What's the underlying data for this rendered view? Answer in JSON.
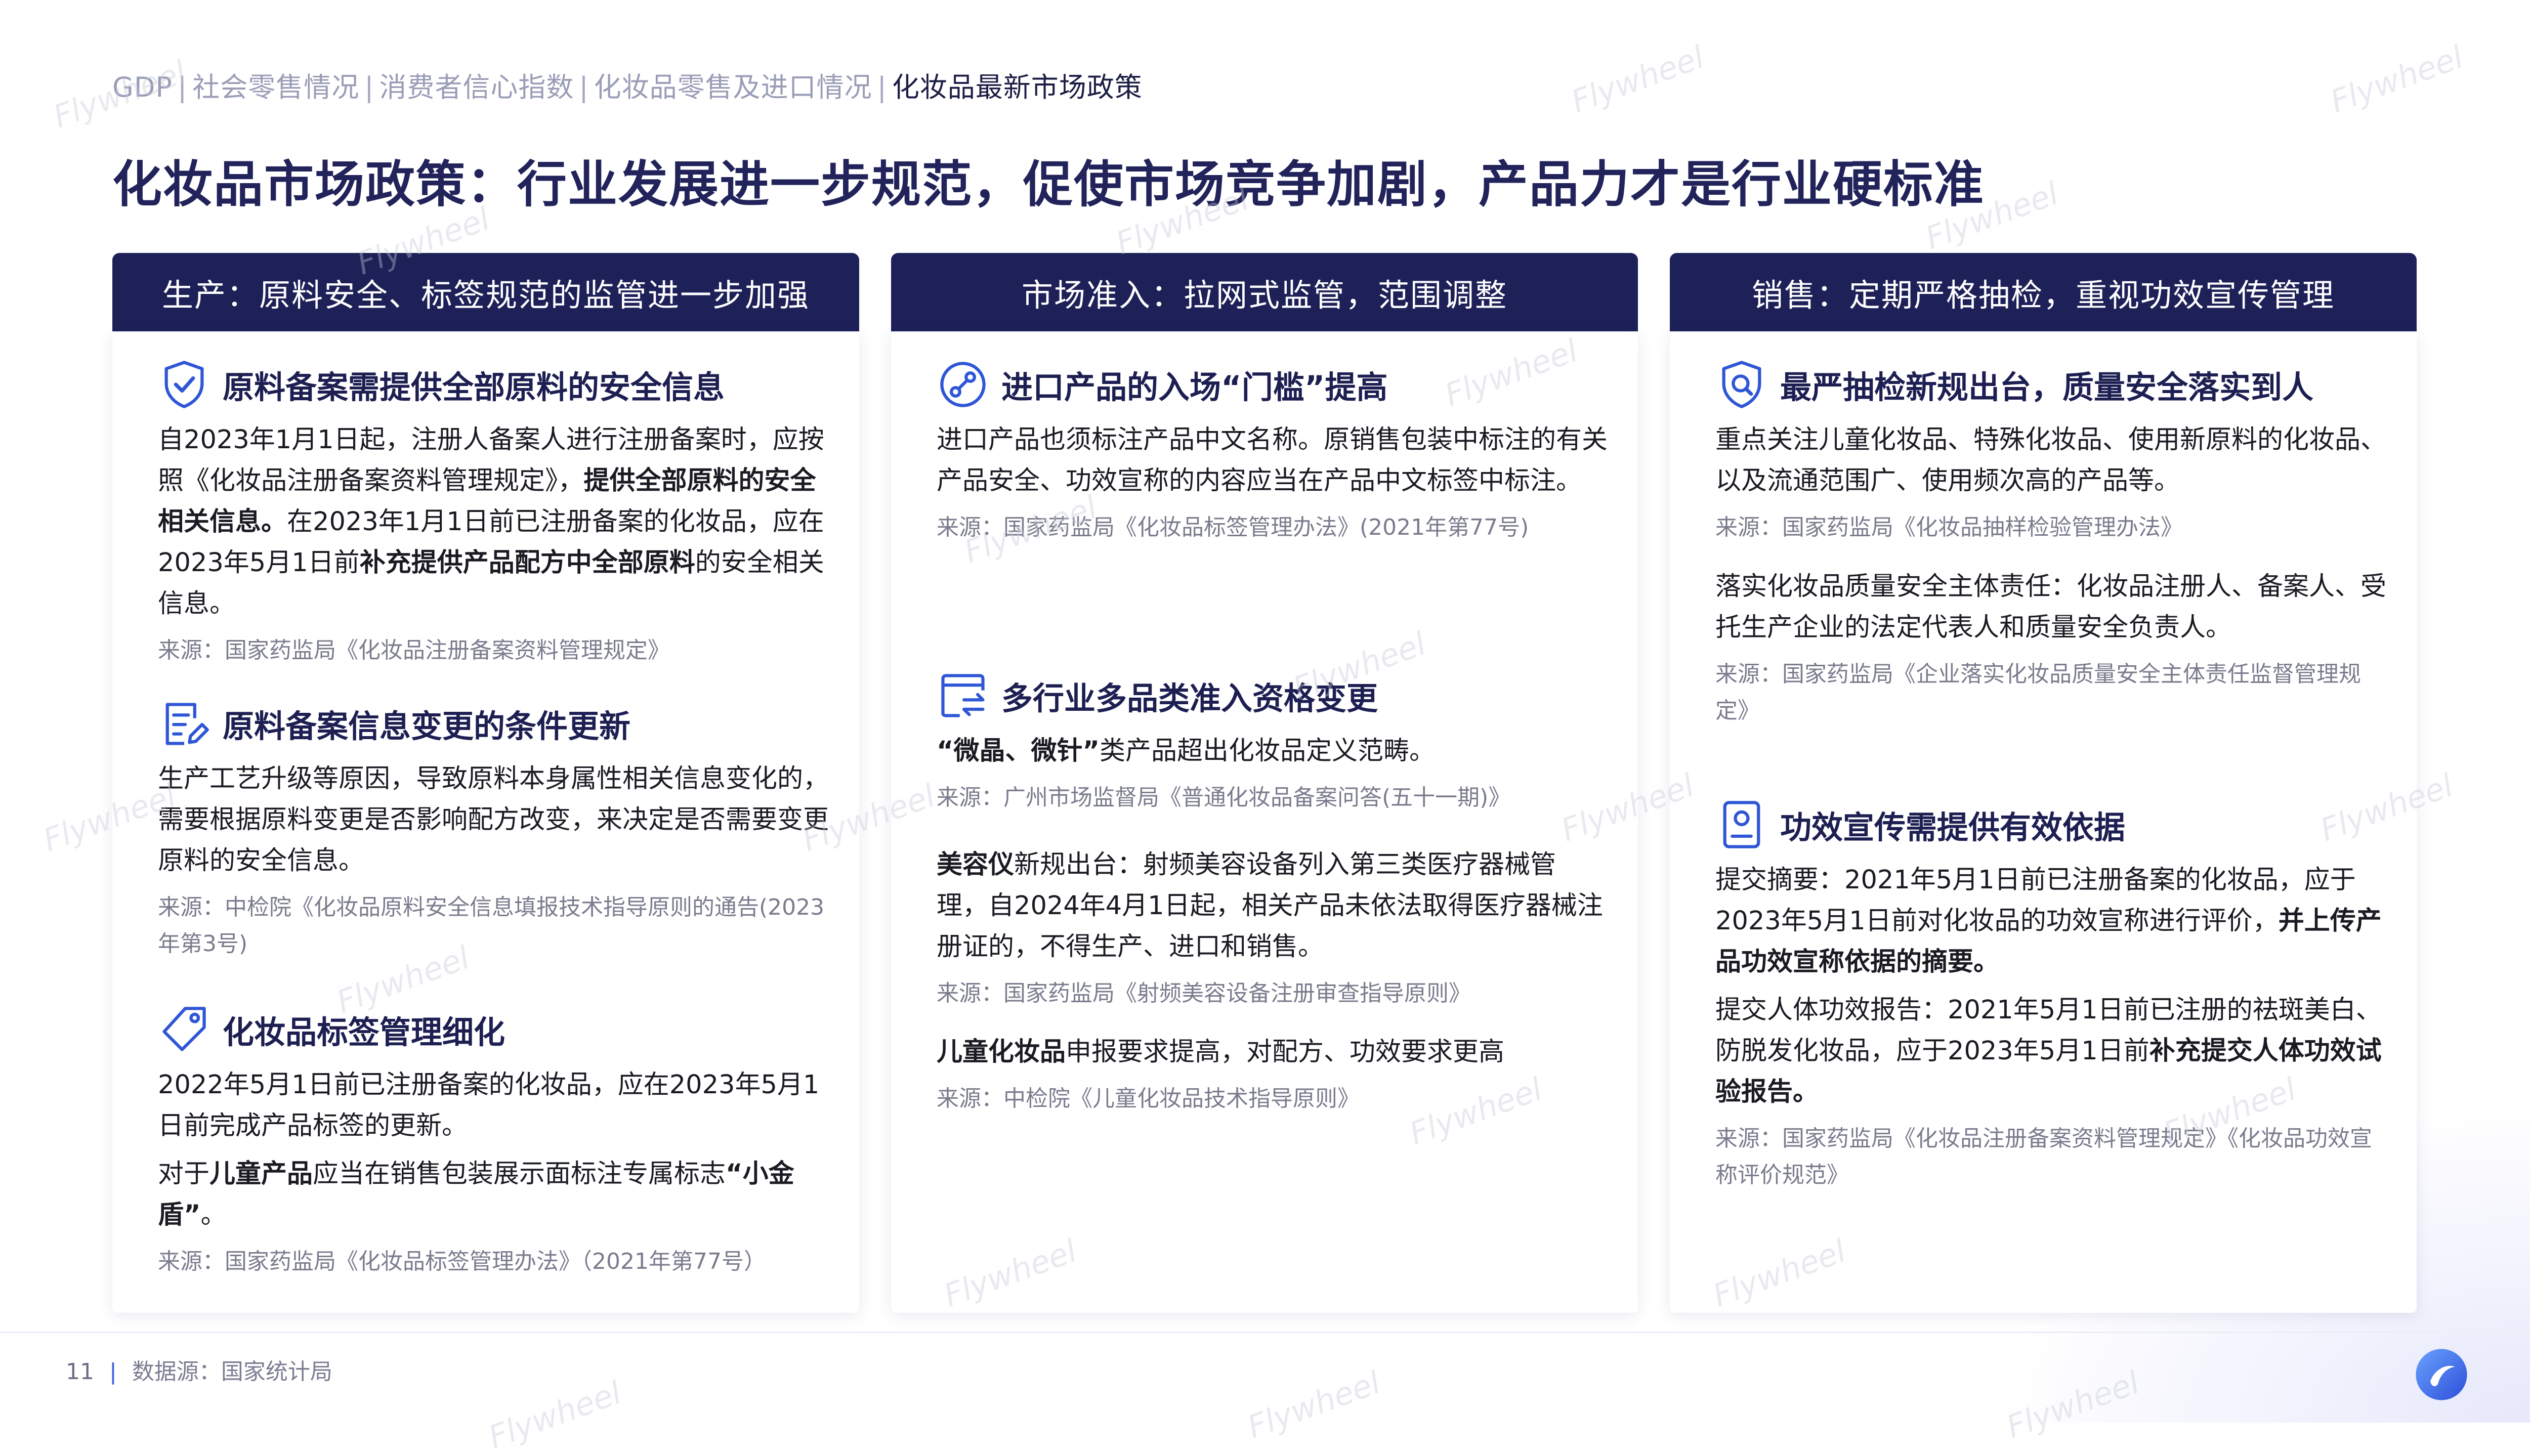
{
  "breadcrumb": {
    "items": [
      "GDP",
      "社会零售情况",
      "消费者信心指数",
      "化妆品零售及进口情况",
      "化妆品最新市场政策"
    ],
    "separator": "|"
  },
  "page_title": "化妆品市场政策：行业发展进一步规范，促使市场竞争加剧，产品力才是行业硬标准",
  "columns": [
    {
      "header": "生产：原料安全、标签规范的监管进一步加强",
      "sections": [
        {
          "icon": "shield-check-icon",
          "title": "原料备案需提供全部原料的安全信息",
          "paragraphs": [
            [
              {
                "t": "自2023年1月1日起，注册人备案人进行注册备案时，应按照《化妆品注册备案资料管理规定》，",
                "b": false
              },
              {
                "t": "提供全部原料的安全相关信息。",
                "b": true
              },
              {
                "t": "在2023年1月1日前已注册备案的化妆品，应在2023年5月1日前",
                "b": false
              },
              {
                "t": "补充提供产品配方中全部原料",
                "b": true
              },
              {
                "t": "的安全相关信息。",
                "b": false
              }
            ]
          ],
          "source": "来源：国家药监局《化妆品注册备案资料管理规定》"
        },
        {
          "icon": "document-edit-icon",
          "title": "原料备案信息变更的条件更新",
          "paragraphs": [
            [
              {
                "t": "生产工艺升级等原因，导致原料本身属性相关信息变化的，需要根据原料变更是否影响配方改变，来决定是否需要变更原料的安全信息。",
                "b": false
              }
            ]
          ],
          "source": "来源：中检院《化妆品原料安全信息填报技术指导原则的通告(2023年第3号)"
        },
        {
          "icon": "tag-icon",
          "title": "化妆品标签管理细化",
          "paragraphs": [
            [
              {
                "t": "2022年5月1日前已注册备案的化妆品，应在2023年5月1日前完成产品标签的更新。",
                "b": false
              }
            ],
            [
              {
                "t": "对于",
                "b": false
              },
              {
                "t": "儿童产品",
                "b": true
              },
              {
                "t": "应当在销售包装展示面标注专属标志",
                "b": false
              },
              {
                "t": "“小金盾”",
                "b": true
              },
              {
                "t": "。",
                "b": false
              }
            ]
          ],
          "source": "来源：国家药监局《化妆品标签管理办法》（2021年第77号）"
        }
      ]
    },
    {
      "header": "市场准入：拉网式监管，范围调整",
      "sections": [
        {
          "icon": "globe-route-icon",
          "title": "进口产品的入场“门槛”提高",
          "paragraphs": [
            [
              {
                "t": "进口产品也须标注产品中文名称。原销售包装中标注的有关产品安全、功效宣称的内容应当在产品中文标签中标注。",
                "b": false
              }
            ]
          ],
          "source": "来源：国家药监局《化妆品标签管理办法》(2021年第77号)"
        },
        {
          "icon": "category-exchange-icon",
          "title": "多行业多品类准入资格变更",
          "paragraphs": [
            [
              {
                "t": "“微晶、微针”",
                "b": true
              },
              {
                "t": "类产品超出化妆品定义范畴。",
                "b": false
              }
            ]
          ],
          "source": "来源：广州市场监督局《普通化妆品备案问答(五十一期)》"
        },
        {
          "icon": "",
          "title": "",
          "paragraphs": [
            [
              {
                "t": "美容仪",
                "b": true
              },
              {
                "t": "新规出台：射频美容设备列入第三类医疗器械管理，自2024年4月1日起，相关产品未依法取得医疗器械注册证的，不得生产、进口和销售。",
                "b": false
              }
            ]
          ],
          "source": "来源：国家药监局《射频美容设备注册审查指导原则》"
        },
        {
          "icon": "",
          "title": "",
          "paragraphs": [
            [
              {
                "t": "儿童化妆品",
                "b": true
              },
              {
                "t": "申报要求提高，对配方、功效要求更高",
                "b": false
              }
            ]
          ],
          "source": "来源：中检院《儿童化妆品技术指导原则》"
        }
      ]
    },
    {
      "header": "销售：定期严格抽检，重视功效宣传管理",
      "sections": [
        {
          "icon": "shield-search-icon",
          "title": "最严抽检新规出台，质量安全落实到人",
          "paragraphs": [
            [
              {
                "t": "重点关注儿童化妆品、特殊化妆品、使用新原料的化妆品、以及流通范围广、使用频次高的产品等。",
                "b": false
              }
            ]
          ],
          "source": "来源：国家药监局《化妆品抽样检验管理办法》"
        },
        {
          "icon": "",
          "title": "",
          "paragraphs": [
            [
              {
                "t": "落实化妆品质量安全主体责任：化妆品注册人、备案人、受托生产企业的法定代表人和质量安全负责人。",
                "b": false
              }
            ]
          ],
          "source": "来源：国家药监局《企业落实化妆品质量安全主体责任监督管理规定》"
        },
        {
          "icon": "id-badge-icon",
          "title": "功效宣传需提供有效依据",
          "paragraphs": [
            [
              {
                "t": "提交摘要：2021年5月1日前已注册备案的化妆品，应于2023年5月1日前对化妆品的功效宣称进行评价，",
                "b": false
              },
              {
                "t": "并上传产品功效宣称依据的摘要。",
                "b": true
              }
            ],
            [
              {
                "t": "提交人体功效报告：2021年5月1日前已注册的祛斑美白、防脱发化妆品，应于2023年5月1日前",
                "b": false
              },
              {
                "t": "补充提交人体功效试验报告。",
                "b": true
              }
            ]
          ],
          "source": "来源：国家药监局《化妆品注册备案资料管理规定》《化妆品功效宣称评价规范》"
        }
      ]
    }
  ],
  "footer": {
    "page_number": "11",
    "data_source": "数据源：国家统计局"
  },
  "watermark": "Flywheel",
  "colors": {
    "header_bg": "#1e2158",
    "title": "#21235a",
    "icon_blue": "#2f56d6",
    "nav_muted": "#9a9db7",
    "source_gray": "#7a7c8d"
  }
}
